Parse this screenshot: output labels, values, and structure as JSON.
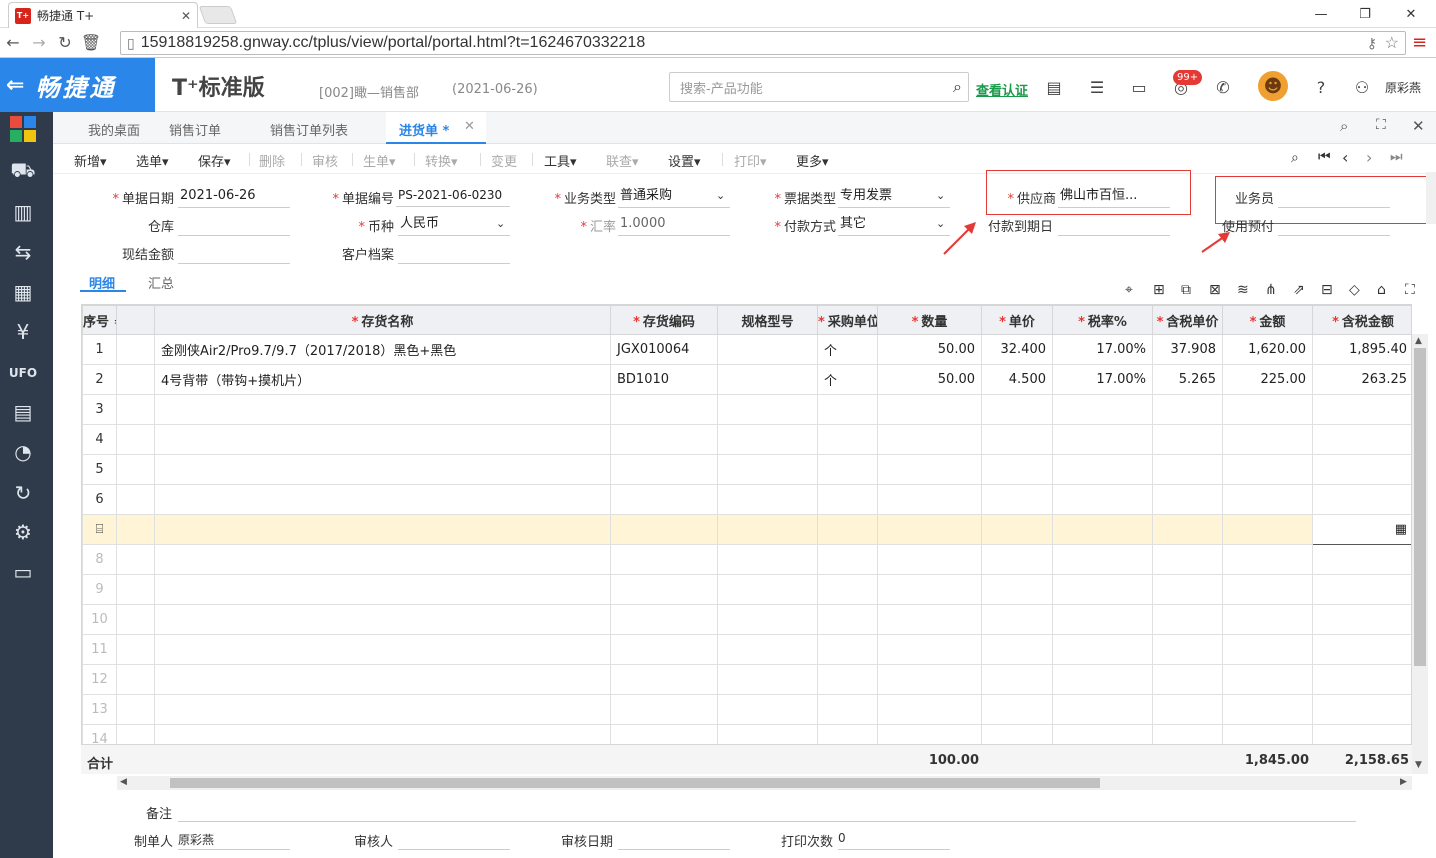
{
  "browser": {
    "tab_title": "畅捷通 T+",
    "favicon_text": "T+",
    "url": "15918819258.gnway.cc/tplus/view/portal/portal.html?t=1624670332218"
  },
  "header": {
    "brand": "畅捷通",
    "product": "T⁺标准版",
    "org": "[002]瞰—销售部",
    "date": "(2021-06-26)",
    "search_placeholder": "搜索-产品功能",
    "verify": "查看认证",
    "badge": "99+",
    "user": "原彩燕"
  },
  "tabs": [
    "我的桌面",
    "销售订单",
    "销售订单列表",
    "进货单 *"
  ],
  "toolbar": [
    "新增",
    "选单",
    "保存",
    "删除",
    "审核",
    "生单",
    "转换",
    "变更",
    "工具",
    "联查",
    "设置",
    "打印",
    "更多"
  ],
  "form": {
    "doc_date_label": "单据日期",
    "doc_date": "2021-06-26",
    "doc_no_label": "单据编号",
    "doc_no": "PS-2021-06-0230",
    "biz_type_label": "业务类型",
    "biz_type": "普通采购",
    "invoice_type_label": "票据类型",
    "invoice_type": "专用发票",
    "supplier_label": "供应商",
    "supplier": "佛山市百恒...",
    "salesman_label": "业务员",
    "warehouse_label": "仓库",
    "currency_label": "币种",
    "currency": "人民币",
    "rate_label": "汇率",
    "rate": "1.0000",
    "pay_method_label": "付款方式",
    "pay_method": "其它",
    "due_date_label": "付款到期日",
    "prepay_label": "使用预付",
    "cash_label": "现结金额",
    "customer_label": "客户档案"
  },
  "subtabs": [
    "明细",
    "汇总"
  ],
  "grid": {
    "headers": [
      "序号",
      "",
      "存货名称",
      "存货编码",
      "规格型号",
      "采购单位",
      "数量",
      "单价",
      "税率%",
      "含税单价",
      "金额",
      "含税金额"
    ],
    "rows": [
      {
        "no": "1",
        "name": "金刚侠Air2/Pro9.7/9.7（2017/2018）黑色+黑色",
        "code": "JGX010064",
        "spec": "",
        "unit": "个",
        "qty": "50.00",
        "price": "32.400",
        "tax": "17.00%",
        "tprice": "37.908",
        "amount": "1,620.00",
        "tamount": "1,895.40"
      },
      {
        "no": "2",
        "name": "4号背带（带钩+摸机片）",
        "code": "BD1010",
        "spec": "",
        "unit": "个",
        "qty": "50.00",
        "price": "4.500",
        "tax": "17.00%",
        "tprice": "5.265",
        "amount": "225.00",
        "tamount": "263.25"
      }
    ],
    "empty_rows": [
      "3",
      "4",
      "5",
      "6"
    ],
    "empty_rows_after": [
      "8",
      "9",
      "10",
      "11",
      "12",
      "13",
      "14"
    ],
    "total_label": "合计",
    "total_qty": "100.00",
    "total_amount": "1,845.00",
    "total_tamount": "2,158.65"
  },
  "footer": {
    "remark_label": "备注",
    "maker_label": "制单人",
    "maker": "原彩燕",
    "auditor_label": "审核人",
    "audit_date_label": "审核日期",
    "print_count_label": "打印次数",
    "print_count": "0"
  }
}
